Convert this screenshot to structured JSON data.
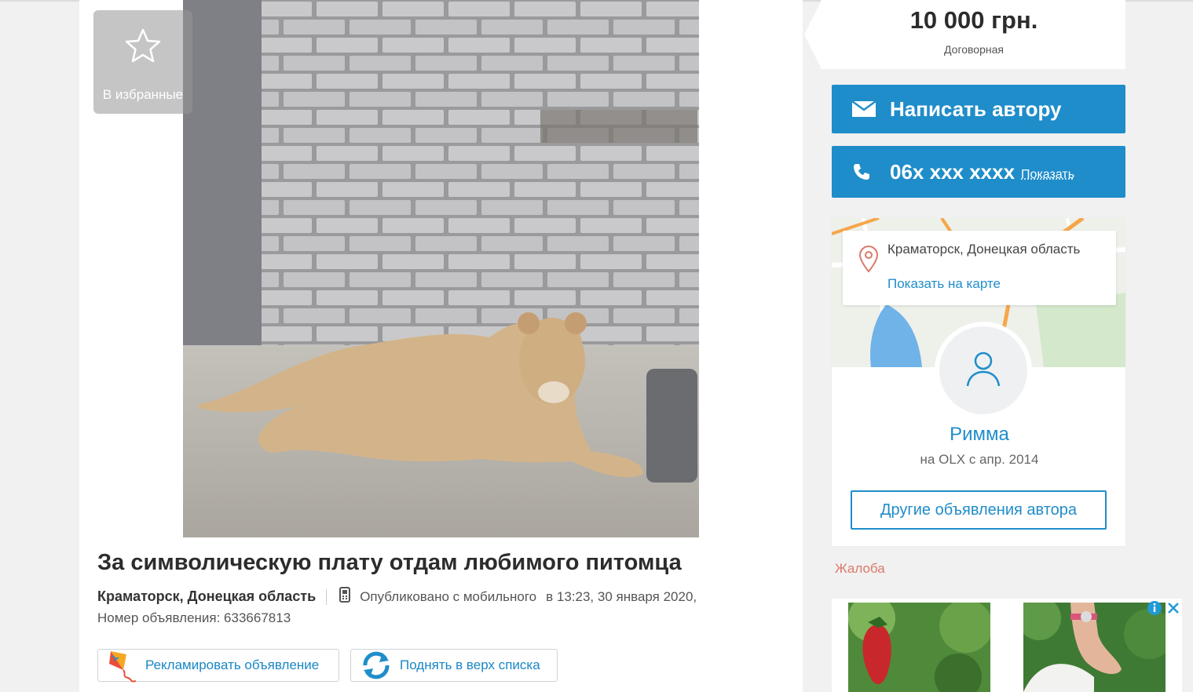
{
  "favorites": {
    "label": "В избранные",
    "icon": "star-icon"
  },
  "listing": {
    "title": "За символическую плату отдам любимого питомца",
    "location": "Краматорск, Донецкая область",
    "posted_from": "Опубликовано с мобильного",
    "posted_at": "в 13:23, 30 января 2020,",
    "ad_number": "Номер объявления: 633667813"
  },
  "actions": {
    "promote_label": "Рекламировать объявление",
    "raise_label": "Поднять в верх списка"
  },
  "price": {
    "value": "10 000 грн.",
    "note": "Договорная"
  },
  "contact": {
    "write_label": "Написать автору",
    "phone_masked": "06x xxx xxxx",
    "show_label": "Показать"
  },
  "location_card": {
    "city": "Краматорск, Донецкая область",
    "map_link": "Показать на карте"
  },
  "seller": {
    "name": "Римма",
    "since": "на OLX с апр. 2014",
    "other_ads_label": "Другие объявления автора"
  },
  "complaint_label": "Жалоба",
  "colors": {
    "accent": "#1f8dca",
    "complaint": "#d97a6a"
  }
}
